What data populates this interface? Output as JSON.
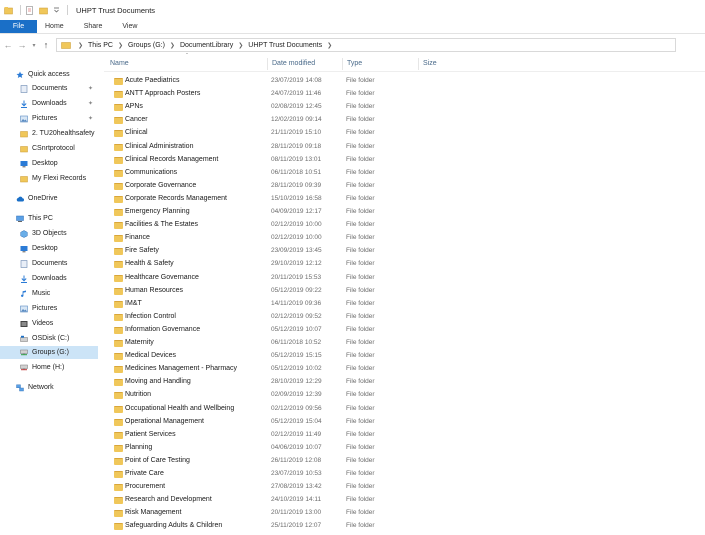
{
  "window": {
    "title": "UHPT Trust Documents"
  },
  "ribbon": {
    "file": "File",
    "tabs": [
      "Home",
      "Share",
      "View"
    ]
  },
  "address": {
    "crumbs": [
      "This PC",
      "Groups (G:)",
      "DocumentLibrary",
      "UHPT Trust Documents"
    ]
  },
  "nav": {
    "quick_access": "Quick access",
    "quick_items": [
      "Documents",
      "Downloads",
      "Pictures",
      "2. TU20healthsafety",
      "CSnrtprotocol",
      "Desktop",
      "My Flexi Records"
    ],
    "onedrive": "OneDrive",
    "this_pc": "This PC",
    "pc_items": [
      "3D Objects",
      "Desktop",
      "Documents",
      "Downloads",
      "Music",
      "Pictures",
      "Videos",
      "OSDisk (C:)",
      "Groups (G:)",
      "Home (H:)"
    ],
    "network": "Network"
  },
  "columns": {
    "name": "Name",
    "date": "Date modified",
    "type": "Type",
    "size": "Size"
  },
  "files": [
    {
      "name": "Acute Paediatrics",
      "date": "23/07/2019 14:08",
      "type": "File folder"
    },
    {
      "name": "ANTT Approach Posters",
      "date": "24/07/2019 11:46",
      "type": "File folder"
    },
    {
      "name": "APNs",
      "date": "02/08/2019 12:45",
      "type": "File folder"
    },
    {
      "name": "Cancer",
      "date": "12/02/2019 09:14",
      "type": "File folder"
    },
    {
      "name": "Clinical",
      "date": "21/11/2019 15:10",
      "type": "File folder"
    },
    {
      "name": "Clinical Administration",
      "date": "28/11/2019 09:18",
      "type": "File folder"
    },
    {
      "name": "Clinical Records Management",
      "date": "08/11/2019 13:01",
      "type": "File folder"
    },
    {
      "name": "Communications",
      "date": "06/11/2018 10:51",
      "type": "File folder"
    },
    {
      "name": "Corporate Governance",
      "date": "28/11/2019 09:39",
      "type": "File folder"
    },
    {
      "name": "Corporate Records Management",
      "date": "15/10/2019 16:58",
      "type": "File folder"
    },
    {
      "name": "Emergency Planning",
      "date": "04/09/2019 12:17",
      "type": "File folder"
    },
    {
      "name": "Facilities & The Estates",
      "date": "02/12/2019 10:00",
      "type": "File folder"
    },
    {
      "name": "Finance",
      "date": "02/12/2019 10:00",
      "type": "File folder"
    },
    {
      "name": "Fire Safety",
      "date": "23/09/2019 13:45",
      "type": "File folder"
    },
    {
      "name": "Health & Safety",
      "date": "29/10/2019 12:12",
      "type": "File folder"
    },
    {
      "name": "Healthcare Governance",
      "date": "20/11/2019 15:53",
      "type": "File folder"
    },
    {
      "name": "Human Resources",
      "date": "05/12/2019 09:22",
      "type": "File folder"
    },
    {
      "name": "IM&T",
      "date": "14/11/2019 09:36",
      "type": "File folder"
    },
    {
      "name": "Infection Control",
      "date": "02/12/2019 09:52",
      "type": "File folder"
    },
    {
      "name": "Information Governance",
      "date": "05/12/2019 10:07",
      "type": "File folder"
    },
    {
      "name": "Maternity",
      "date": "06/11/2018 10:52",
      "type": "File folder"
    },
    {
      "name": "Medical Devices",
      "date": "05/12/2019 15:15",
      "type": "File folder"
    },
    {
      "name": "Medicines Management - Pharmacy",
      "date": "05/12/2019 10:02",
      "type": "File folder"
    },
    {
      "name": "Moving and Handling",
      "date": "28/10/2019 12:29",
      "type": "File folder"
    },
    {
      "name": "Nutrition",
      "date": "02/09/2019 12:39",
      "type": "File folder"
    },
    {
      "name": "Occupational Health and Wellbeing",
      "date": "02/12/2019 09:56",
      "type": "File folder"
    },
    {
      "name": "Operational Management",
      "date": "05/12/2019 15:04",
      "type": "File folder"
    },
    {
      "name": "Patient Services",
      "date": "02/12/2019 11:49",
      "type": "File folder"
    },
    {
      "name": "Planning",
      "date": "04/06/2019 10:07",
      "type": "File folder"
    },
    {
      "name": "Point of Care Testing",
      "date": "26/11/2019 12:08",
      "type": "File folder"
    },
    {
      "name": "Private Care",
      "date": "23/07/2019 10:53",
      "type": "File folder"
    },
    {
      "name": "Procurement",
      "date": "27/08/2019 13:42",
      "type": "File folder"
    },
    {
      "name": "Research and Development",
      "date": "24/10/2019 14:11",
      "type": "File folder"
    },
    {
      "name": "Risk Management",
      "date": "20/11/2019 13:00",
      "type": "File folder"
    },
    {
      "name": "Safeguarding Adults & Children",
      "date": "25/11/2019 12:07",
      "type": "File folder"
    }
  ],
  "colors": {
    "accent": "#1a6fc7",
    "folder": "#f0c75a",
    "selection": "#cce4f7"
  }
}
